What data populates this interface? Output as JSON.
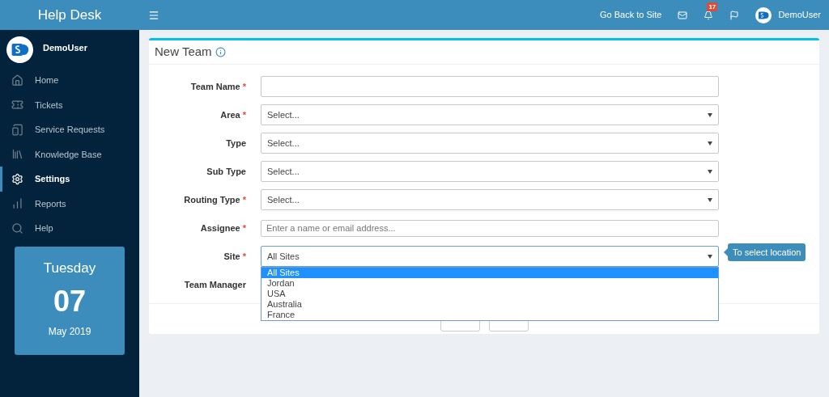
{
  "brand": "Help Desk",
  "topbar": {
    "link": "Go Back to Site",
    "notifications": "17",
    "user": "DemoUser"
  },
  "sidebar": {
    "user": "DemoUser",
    "items": [
      {
        "label": "Home",
        "selected": false
      },
      {
        "label": "Tickets",
        "selected": false
      },
      {
        "label": "Service Requests",
        "selected": false
      },
      {
        "label": "Knowledge Base",
        "selected": false
      },
      {
        "label": "Settings",
        "selected": true
      },
      {
        "label": "Reports",
        "selected": false
      },
      {
        "label": "Help",
        "selected": false
      }
    ]
  },
  "calendar": {
    "day": "Tuesday",
    "date": "07",
    "month_year": "May 2019"
  },
  "form": {
    "title": "New Team",
    "fields": [
      {
        "label": "Team Name",
        "required_mark": "*",
        "kind": "text"
      },
      {
        "label": "Area",
        "required_mark": "*",
        "kind": "select",
        "value": "Select..."
      },
      {
        "label": "Type",
        "kind": "select",
        "value": "Select..."
      },
      {
        "label": "Sub Type",
        "kind": "select",
        "value": "Select..."
      },
      {
        "label": "Routing Type",
        "required_mark": "*",
        "kind": "select",
        "value": "Select..."
      },
      {
        "label": "Assignee",
        "required_mark": "*",
        "kind": "text",
        "placeholder": "Enter a name or email address..."
      },
      {
        "label": "Site",
        "required_mark": "*",
        "kind": "select",
        "value": "All Sites",
        "tooltip": "To select location",
        "expanded": true,
        "options": [
          {
            "label": "All Sites",
            "selected": true
          },
          {
            "label": "Jordan",
            "selected": false
          },
          {
            "label": "USA",
            "selected": false
          },
          {
            "label": "Australia",
            "selected": false
          },
          {
            "label": "France",
            "selected": false
          }
        ]
      },
      {
        "label": "Team Manager",
        "kind": "covered"
      }
    ]
  }
}
